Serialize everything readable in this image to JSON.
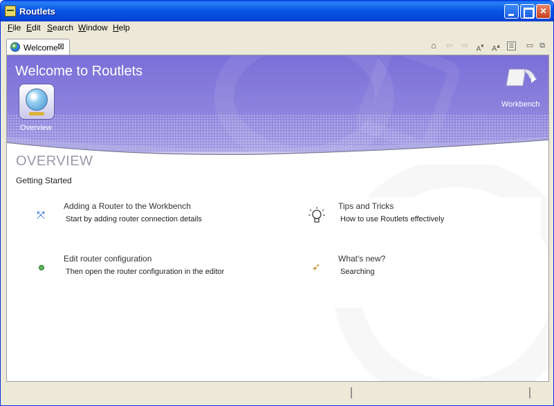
{
  "window": {
    "title": "Routlets"
  },
  "menu": {
    "items": [
      "File",
      "Edit",
      "Search",
      "Window",
      "Help"
    ]
  },
  "tab": {
    "label": "Welcome",
    "close": "⊠"
  },
  "banner": {
    "title": "Welcome to Routlets",
    "overview_label": "Overview",
    "workbench_label": "Workbench"
  },
  "section": {
    "title": "OVERVIEW",
    "subtitle": "Getting Started"
  },
  "links": [
    {
      "icon": "router-add-icon",
      "title": "Adding a Router to the Workbench",
      "desc": "Start by adding router connection details"
    },
    {
      "icon": "lightbulb-icon",
      "title": "Tips and Tricks",
      "desc": "How to use Routlets effectively"
    },
    {
      "icon": "green-dot-icon",
      "title": "Edit router configuration",
      "desc": "Then open the router configuration in the editor"
    },
    {
      "icon": "rocket-icon",
      "title": "What's new?",
      "desc": "Searching"
    }
  ],
  "colors": {
    "banner": "#7a6fd8",
    "titlebar": "#0a57e4"
  }
}
